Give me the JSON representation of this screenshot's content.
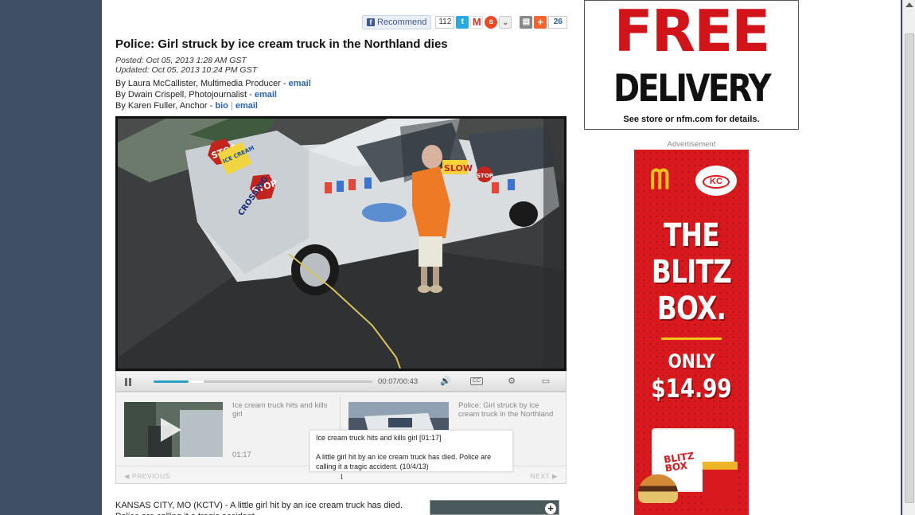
{
  "share": {
    "recommend_label": "Recommend",
    "recommend_count": "112",
    "share_count": "26"
  },
  "article": {
    "headline": "Police: Girl struck by ice cream truck in the Northland dies",
    "posted": "Posted: Oct 05, 2013 1:28 AM GST",
    "updated": "Updated: Oct 05, 2013 10:24 PM GST",
    "bylines": [
      {
        "text": "By Laura McCallister, Multimedia Producer - ",
        "link1": "email",
        "sep": "",
        "link2": ""
      },
      {
        "text": "By Dwain Crispell, Photojournalist - ",
        "link1": "email",
        "sep": "",
        "link2": ""
      },
      {
        "text": "By Karen Fuller, Anchor - ",
        "link1": "bio",
        "sep": "|",
        "link2": "email"
      }
    ],
    "body_start": "KANSAS CITY, MO (KCTV) -  A little girl hit by an ice cream truck has died. Police are calling it a tragic accident."
  },
  "video": {
    "timecode": "00:07/00:43",
    "progress_fraction": 0.16,
    "buffered_fraction": 0.23,
    "truck_signs": [
      "STOP",
      "STOP",
      "SLOW",
      "STOP",
      "ICE CREAM",
      "CROSSING"
    ]
  },
  "playlist": {
    "items": [
      {
        "title": "Ice cream truck hits and kills girl",
        "duration": "01:17"
      },
      {
        "title": "Police: Girl struck by ice cream truck in the Northland",
        "duration": ""
      }
    ],
    "prev_label": "◀ PREVIOUS",
    "next_label": "NEXT ▶",
    "page": "1",
    "tooltip_title": "Ice cream truck hits and kills girl  [01:17]",
    "tooltip_desc": "A little girl hit by an ice cream truck has died. Police are calling it a tragic accident. (10/4/13)"
  },
  "ads": {
    "top_line1": "FREE",
    "top_line2": "DELIVERY",
    "top_small": "See store or nfm.com for details.",
    "label": "Advertisement",
    "mcd_blitz": [
      "THE",
      "BLITZ",
      "BOX."
    ],
    "mcd_only": "ONLY",
    "mcd_price": "$14.99",
    "mcd_box_text": [
      "BLITZ",
      "BOX"
    ],
    "accent_red": "#d81a1f",
    "accent_yellow": "#f7c21a"
  }
}
